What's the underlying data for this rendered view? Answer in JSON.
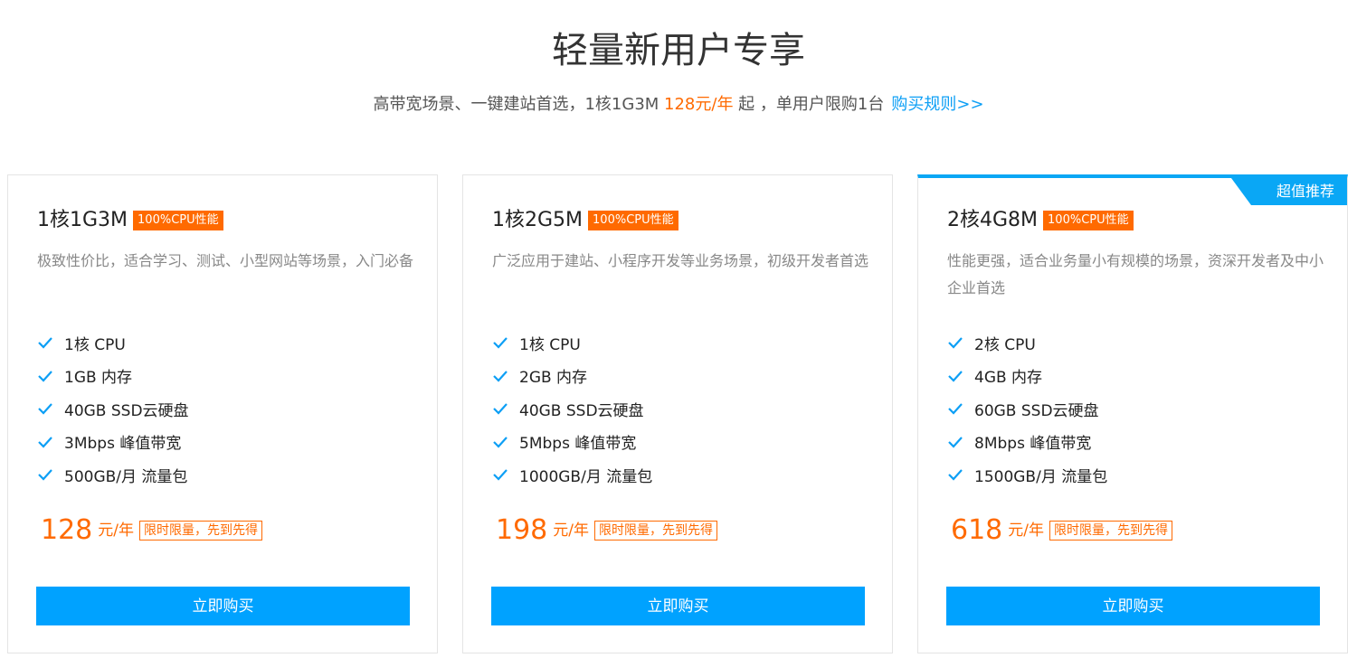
{
  "header": {
    "title": "轻量新用户专享",
    "subtitle_prefix": "高带宽场景、一键建站首选，1核1G3M ",
    "subtitle_price": "128元/年",
    "subtitle_suffix": " 起 ，单用户限购1台",
    "rules_link": "购买规则>>"
  },
  "accent_colors": {
    "orange": "#ff6a00",
    "blue": "#00a2ff"
  },
  "plans": [
    {
      "name": "1核1G3M",
      "badge": "100%CPU性能",
      "description": "极致性价比，适合学习、测试、小型网站等场景，入门必备",
      "features": [
        "1核 CPU",
        "1GB 内存",
        "40GB SSD云硬盘",
        "3Mbps 峰值带宽",
        "500GB/月 流量包"
      ],
      "price": "128",
      "price_unit": "元/年",
      "limit_tag": "限时限量，先到先得",
      "buy_label": "立即购买"
    },
    {
      "name": "1核2G5M",
      "badge": "100%CPU性能",
      "description": "广泛应用于建站、小程序开发等业务场景，初级开发者首选",
      "features": [
        "1核 CPU",
        "2GB 内存",
        "40GB SSD云硬盘",
        "5Mbps 峰值带宽",
        "1000GB/月 流量包"
      ],
      "price": "198",
      "price_unit": "元/年",
      "limit_tag": "限时限量，先到先得",
      "buy_label": "立即购买"
    },
    {
      "name": "2核4G8M",
      "badge": "100%CPU性能",
      "ribbon": "超值推荐",
      "description": "性能更强，适合业务量小有规模的场景，资深开发者及中小企业首选",
      "features": [
        "2核 CPU",
        "4GB 内存",
        "60GB SSD云硬盘",
        "8Mbps 峰值带宽",
        "1500GB/月 流量包"
      ],
      "price": "618",
      "price_unit": "元/年",
      "limit_tag": "限时限量，先到先得",
      "buy_label": "立即购买"
    }
  ]
}
